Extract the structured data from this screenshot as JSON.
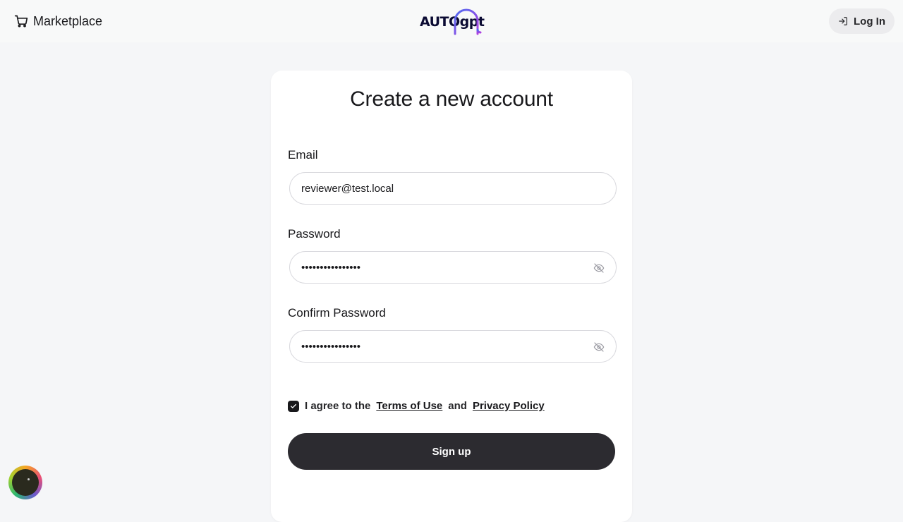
{
  "header": {
    "marketplace_label": "Marketplace",
    "logo_text": "AUTOgpt",
    "login_label": "Log In"
  },
  "form": {
    "title": "Create a new account",
    "email_label": "Email",
    "email_value": "reviewer@test.local",
    "password_label": "Password",
    "password_value": "••••••••••••••••",
    "confirm_label": "Confirm Password",
    "confirm_value": "••••••••••••••••",
    "agree_prefix": "I agree to the",
    "terms_link": "Terms of Use",
    "agree_and": "and",
    "privacy_link": "Privacy Policy",
    "agree_checked": true,
    "signup_label": "Sign up"
  },
  "icons": {
    "cart": "cart-icon",
    "login": "login-icon",
    "eye_off": "eye-off-icon",
    "check": "check-icon",
    "assistant": "assistant-icon"
  },
  "colors": {
    "primary_button": "#2c2b30",
    "logo_gradient_start": "#4f6bf0",
    "logo_gradient_end": "#b040e0"
  }
}
